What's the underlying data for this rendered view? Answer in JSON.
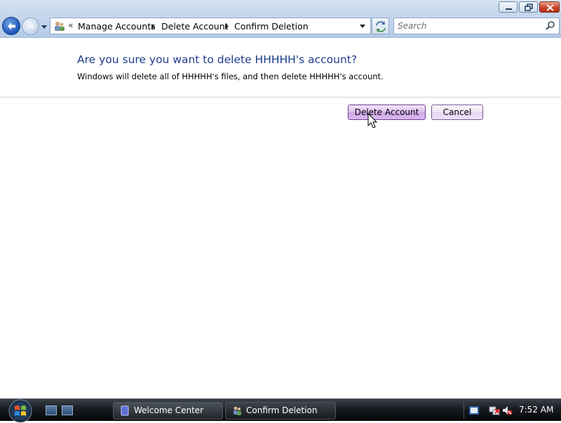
{
  "window": {
    "controls": {
      "minimize_icon": "minimize-icon",
      "maximize_icon": "restore-icon",
      "close_icon": "close-icon"
    }
  },
  "navigation": {
    "back_icon": "back-arrow-icon",
    "forward_icon": "forward-arrow-icon",
    "address": {
      "icon": "user-accounts-icon",
      "breadcrumbs": [
        "Manage Accounts",
        "Delete Account",
        "Confirm Deletion"
      ]
    },
    "search": {
      "placeholder": "Search"
    }
  },
  "dialog": {
    "heading": "Are you sure you want to delete HHHHH's account?",
    "message": "Windows will delete all of HHHHH's files, and then delete HHHHH's account.",
    "buttons": {
      "delete_label": "Delete Account",
      "cancel_label": "Cancel"
    }
  },
  "taskbar": {
    "tasks": [
      {
        "label": "Welcome Center",
        "icon": "welcome-center-icon"
      },
      {
        "label": "Confirm Deletion",
        "icon": "user-accounts-icon"
      }
    ],
    "clock": "7:52 AM"
  },
  "colors": {
    "heading": "#1e3c8c",
    "primary_button": "#dcbcef",
    "taskbar": "#15181d"
  }
}
